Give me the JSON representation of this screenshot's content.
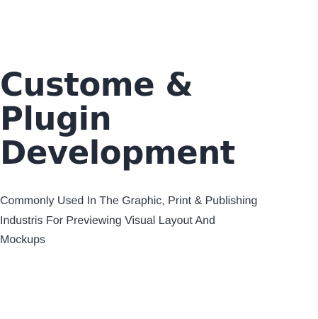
{
  "hero": {
    "headline_line_1": "Custome & Plugin",
    "headline_line_2": "Development",
    "description_line_1": "Commonly Used In The Graphic, Print & Publishing",
    "description_line_2": "Industris For Previewing Visual Layout And",
    "description_line_3": "Mockups"
  },
  "colors": {
    "background": "#ffffff",
    "heading": "#242b38",
    "body_text": "#2f3642"
  }
}
